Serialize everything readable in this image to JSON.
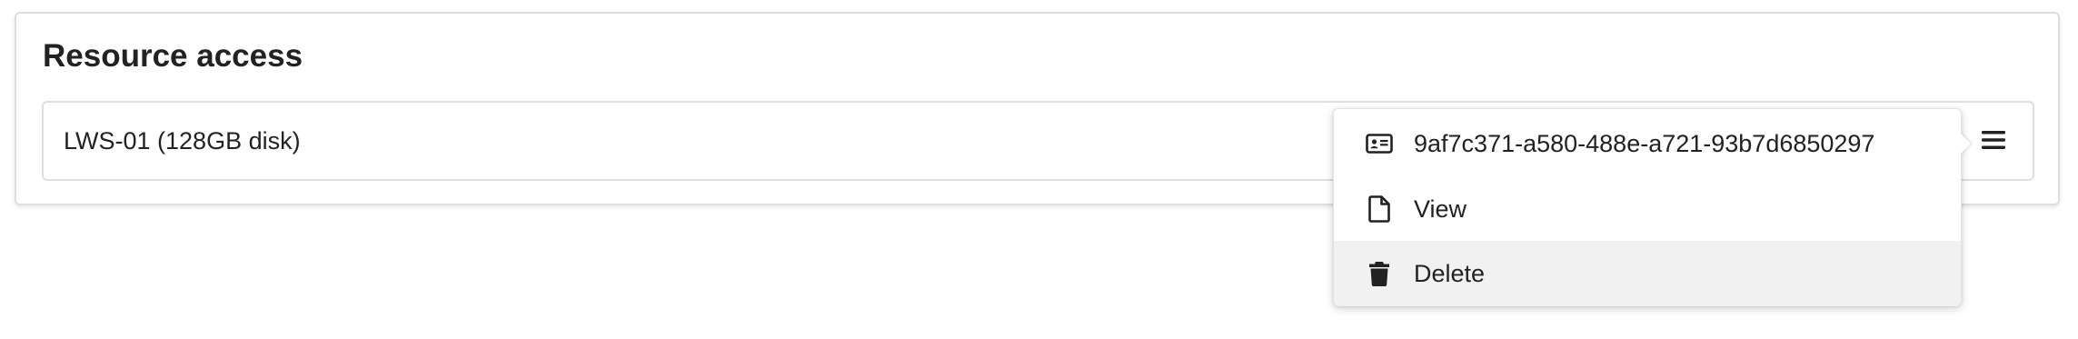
{
  "section": {
    "title": "Resource access"
  },
  "resource": {
    "name": "LWS-01 (128GB disk)"
  },
  "menu": {
    "toggle_icon": "hamburger-icon",
    "items": [
      {
        "label": "9af7c371-a580-488e-a721-93b7d6850297",
        "icon": "id-card-icon",
        "highlighted": false
      },
      {
        "label": "View",
        "icon": "file-icon",
        "highlighted": false
      },
      {
        "label": "Delete",
        "icon": "trash-icon",
        "highlighted": true
      }
    ]
  },
  "colors": {
    "border": "#dedede",
    "highlight": "#f1f1f1",
    "text": "#222222"
  }
}
